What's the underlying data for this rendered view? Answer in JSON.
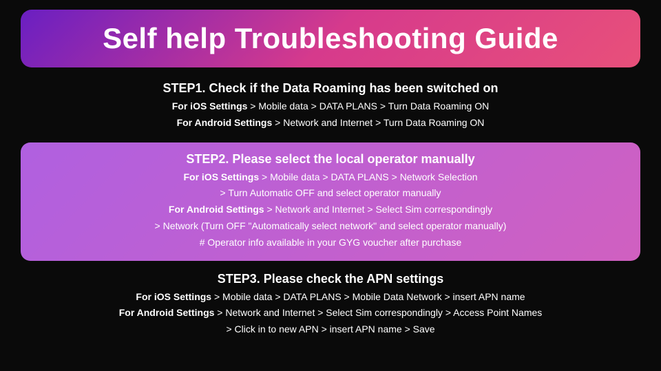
{
  "title": "Self help Troubleshooting Guide",
  "steps": [
    {
      "id": "step1",
      "title": "STEP1. Check if the Data Roaming has been switched on",
      "lines": [
        {
          "bold_part": "For iOS Settings",
          "normal_part": " > Mobile data > DATA PLANS > Turn Data Roaming ON"
        },
        {
          "bold_part": "For Android Settings",
          "normal_part": " > Network and Internet > Turn Data Roaming ON"
        }
      ]
    },
    {
      "id": "step2",
      "title": "STEP2. Please select the local operator manually",
      "lines": [
        {
          "bold_part": "For iOS Settings",
          "normal_part": " > Mobile data > DATA PLANS > Network Selection"
        },
        {
          "bold_part": "",
          "normal_part": "> Turn Automatic OFF and select operator manually"
        },
        {
          "bold_part": "For Android Settings",
          "normal_part": " > Network and Internet > Select Sim correspondingly"
        },
        {
          "bold_part": "",
          "normal_part": "> Network (Turn OFF \"Automatically select network\" and select operator manually)"
        },
        {
          "bold_part": "",
          "normal_part": "# Operator info available in your GYG voucher after purchase"
        }
      ]
    },
    {
      "id": "step3",
      "title": "STEP3. Please check the APN settings",
      "lines": [
        {
          "bold_part": "For iOS Settings",
          "normal_part": " > Mobile data > DATA PLANS > Mobile Data Network > insert APN name"
        },
        {
          "bold_part": "For Android Settings",
          "normal_part": " > Network and Internet > Select Sim correspondingly > Access Point Names"
        },
        {
          "bold_part": "",
          "normal_part": "> Click in to new APN > insert APN name > Save"
        }
      ]
    }
  ]
}
